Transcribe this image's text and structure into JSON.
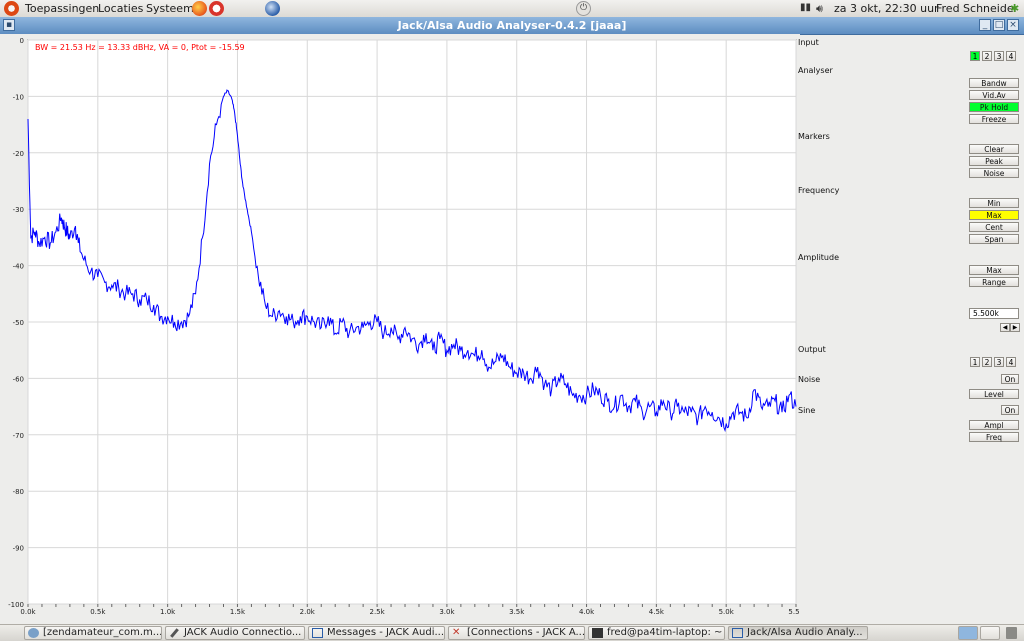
{
  "topbar": {
    "menu_apps": "Toepassingen",
    "menu_places": "Locaties",
    "menu_system": "Systeem",
    "datetime": "za 3 okt, 22:30 uur",
    "user": "Fred Schneider"
  },
  "window": {
    "title": "Jack/Alsa Audio Analyser-0.4.2  [jaaa]"
  },
  "plot": {
    "info": "BW = 21.53 Hz = 13.33 dBHz, VA = 0, Ptot = -15.59",
    "trace_color": "#0000ff",
    "info_color": "#ff0000"
  },
  "chart_data": {
    "type": "line",
    "title": "",
    "xlabel": "",
    "ylabel": "",
    "xlim": [
      0,
      5500
    ],
    "ylim": [
      -100,
      0
    ],
    "x_ticks": [
      "0.0k",
      "0.5k",
      "1.0k",
      "1.5k",
      "2.0k",
      "2.5k",
      "3.0k",
      "3.5k",
      "4.0k",
      "4.5k",
      "5.0k",
      "5.5k"
    ],
    "y_ticks": [
      "0",
      "-10",
      "-20",
      "-30",
      "-40",
      "-50",
      "-60",
      "-70",
      "-80",
      "-90",
      "-100"
    ],
    "grid": true,
    "series": [
      {
        "x": [
          0,
          20,
          50,
          80,
          120,
          160,
          200,
          240,
          260,
          280,
          300,
          340,
          360,
          400,
          450,
          500,
          550,
          600,
          650,
          700,
          750,
          800,
          850,
          900,
          950,
          1000,
          1050,
          1100,
          1150,
          1200,
          1250,
          1300,
          1350,
          1400,
          1430,
          1460,
          1480,
          1500,
          1520,
          1540,
          1570,
          1600,
          1650,
          1700,
          1750,
          1800,
          1850,
          1900,
          1950,
          2000,
          2050,
          2100,
          2150,
          2200,
          2250,
          2300,
          2350,
          2400,
          2450,
          2500,
          2550,
          2600,
          2650,
          2700,
          2750,
          2800,
          2850,
          2900,
          2950,
          3000,
          3050,
          3100,
          3150,
          3200,
          3250,
          3300,
          3350,
          3400,
          3450,
          3500,
          3550,
          3600,
          3650,
          3700,
          3750,
          3800,
          3850,
          3900,
          3950,
          4000,
          4050,
          4100,
          4150,
          4200,
          4250,
          4300,
          4350,
          4400,
          4450,
          4500,
          4550,
          4600,
          4650,
          4700,
          4750,
          4800,
          4850,
          4900,
          4950,
          5000,
          5050,
          5100,
          5150,
          5200,
          5250,
          5300,
          5350,
          5400,
          5450,
          5500
        ],
        "y": [
          -14,
          -35,
          -34,
          -36,
          -35,
          -36,
          -34,
          -31.5,
          -33,
          -34,
          -35,
          -33,
          -36,
          -39,
          -41,
          -42,
          -43,
          -43.5,
          -44,
          -45,
          -45,
          -46,
          -46,
          -47,
          -49,
          -49,
          -50,
          -50,
          -49,
          -45,
          -35,
          -22,
          -15,
          -10,
          -9,
          -10.5,
          -13,
          -17,
          -22,
          -26,
          -30,
          -34,
          -42,
          -47,
          -49,
          -48,
          -49,
          -50,
          -49,
          -49,
          -50,
          -51,
          -49,
          -52,
          -50,
          -52,
          -51,
          -51,
          -50,
          -50,
          -52,
          -51,
          -53,
          -51,
          -53,
          -54,
          -52,
          -55,
          -53,
          -55,
          -54,
          -55,
          -55,
          -56,
          -55,
          -58,
          -57,
          -56,
          -58,
          -59,
          -59,
          -60,
          -58,
          -61,
          -62,
          -60,
          -61,
          -63,
          -63,
          -63,
          -62,
          -63,
          -64,
          -65,
          -63,
          -65,
          -64,
          -66,
          -65,
          -66,
          -64,
          -66,
          -65,
          -66,
          -66,
          -67,
          -65,
          -66,
          -67,
          -68,
          -66,
          -66,
          -67,
          -62,
          -65,
          -65,
          -64,
          -66,
          -63,
          -65
        ]
      }
    ]
  },
  "panel": {
    "input_label": "Input",
    "input_channels": [
      "1",
      "2",
      "3",
      "4"
    ],
    "analyser_label": "Analyser",
    "analyser_buttons": [
      "Bandw",
      "Vid.Av",
      "Pk Hold",
      "Freeze"
    ],
    "markers_label": "Markers",
    "marker_buttons": [
      "Clear",
      "Peak",
      "Noise"
    ],
    "frequency_label": "Frequency",
    "frequency_buttons": [
      "Min",
      "Max",
      "Cent",
      "Span"
    ],
    "amplitude_label": "Amplitude",
    "amplitude_buttons": [
      "Max",
      "Range"
    ],
    "value_field": "5.500k",
    "output_label": "Output",
    "output_channels": [
      "1",
      "2",
      "3",
      "4"
    ],
    "noise_label": "Noise",
    "noise_on": "On",
    "level_button": "Level",
    "sine_label": "Sine",
    "sine_on": "On",
    "ampl_button": "Ampl",
    "freq_button": "Freq",
    "active_color": "#00ff2e",
    "highlight_color": "#ffff00"
  },
  "taskbar": {
    "tasks": [
      "[zendamateur_com.m...",
      "JACK Audio Connectio...",
      "Messages - JACK Audi...",
      "[Connections - JACK A...",
      "fred@pa4tim-laptop: ~",
      "Jack/Alsa Audio Analy..."
    ]
  }
}
